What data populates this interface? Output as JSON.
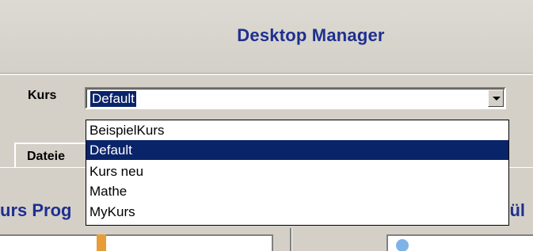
{
  "window": {
    "title": "Desktop Manager"
  },
  "kurs": {
    "label": "Kurs",
    "value": "Default",
    "dropdown_icon": "chevron-down-icon",
    "options": [
      "BeispielKurs",
      "Default",
      "Kurs neu",
      "Mathe",
      "MyKurs"
    ],
    "selected_index": 1
  },
  "tabs": {
    "dateien_partial": "Dateie"
  },
  "panels": {
    "left_title_partial": "urs Prog",
    "right_title_partial": "hül"
  },
  "colors": {
    "title_blue": "#1f2f8f",
    "selection": "#0a246a",
    "window_bg": "#d4d0c8",
    "orange_icon": "#e79c38",
    "blue_icon": "#7eb3e8"
  }
}
